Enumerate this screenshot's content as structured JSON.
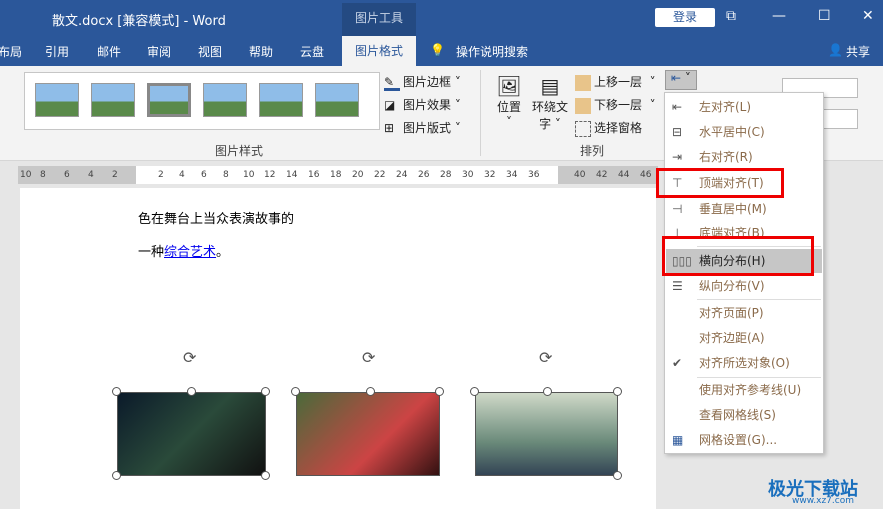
{
  "window": {
    "title": "散文.docx [兼容模式]  -  Word",
    "context_tab": "图片工具",
    "login": "登录",
    "restore": "⧉",
    "minimize": "—",
    "maximize": "☐",
    "close": "✕"
  },
  "tabs": [
    "布局",
    "引用",
    "邮件",
    "审阅",
    "视图",
    "帮助",
    "云盘",
    "图片格式"
  ],
  "tell_me": "操作说明搜索",
  "share": "共享",
  "ribbon": {
    "picture_styles": {
      "border": "图片边框",
      "effects": "图片效果",
      "layout": "图片版式",
      "group": "图片样式"
    },
    "arrange": {
      "position": "位置",
      "wrap_line1": "环绕文",
      "wrap_line2": "字",
      "bring_forward": "上移一层",
      "send_backward": "下移一层",
      "selection_pane": "选择窗格",
      "group": "排列"
    }
  },
  "ruler": [
    "10",
    "8",
    "6",
    "4",
    "2",
    "",
    "2",
    "4",
    "6",
    "8",
    "10",
    "12",
    "14",
    "16",
    "18",
    "20",
    "22",
    "24",
    "26",
    "28",
    "30",
    "32",
    "34",
    "36",
    "",
    "40",
    "42",
    "44",
    "46"
  ],
  "document": {
    "line1": "色在舞台上当众表演故事的",
    "line2_prefix": "一种",
    "line2_link": "综合艺术",
    "line2_suffix": "。"
  },
  "align_menu": {
    "items": [
      {
        "icon": "align-left-icon",
        "label": "左对齐(L)"
      },
      {
        "icon": "align-center-icon",
        "label": "水平居中(C)"
      },
      {
        "icon": "align-right-icon",
        "label": "右对齐(R)"
      },
      {
        "icon": "align-top-icon",
        "label": "顶端对齐(T)"
      },
      {
        "icon": "align-middle-icon",
        "label": "垂直居中(M)"
      },
      {
        "icon": "align-bottom-icon",
        "label": "底端对齐(B)"
      },
      {
        "icon": "distribute-horizontal-icon",
        "label": "横向分布(H)",
        "highlighted": true
      },
      {
        "icon": "distribute-vertical-icon",
        "label": "纵向分布(V)"
      },
      {
        "label": "对齐页面(P)"
      },
      {
        "label": "对齐边距(A)"
      },
      {
        "icon": "check-icon",
        "label": "对齐所选对象(O)",
        "checked": true
      },
      {
        "label": "使用对齐参考线(U)"
      },
      {
        "label": "查看网格线(S)"
      },
      {
        "icon": "grid-icon",
        "label": "网格设置(G)..."
      }
    ]
  },
  "watermark": {
    "name": "极光下载站",
    "url": "www.xz7.com"
  },
  "colors": {
    "titlebar": "#2b579a",
    "highlight_box": "#ee0000",
    "link": "#0000ee"
  }
}
